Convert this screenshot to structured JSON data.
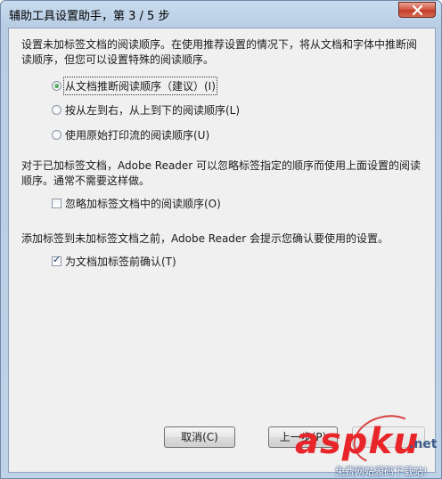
{
  "window": {
    "title": "辅助工具设置助手，第 3 / 5 步"
  },
  "section1": {
    "description": "设置未加标签文档的阅读顺序。在使用推荐设置的情况下，将从文档和字体中推断阅读顺序，但您可以设置特殊的阅读顺序。",
    "options": [
      {
        "label": "从文档推断阅读顺序（建议）(I)",
        "selected": true
      },
      {
        "label": "按从左到右，从上到下的阅读顺序(L)",
        "selected": false
      },
      {
        "label": "使用原始打印流的阅读顺序(U)",
        "selected": false
      }
    ]
  },
  "section2": {
    "description": "对于已加标签文档，Adobe Reader 可以忽略标签指定的顺序而使用上面设置的阅读顺序。通常不需要这样做。",
    "checkbox_label": "忽略加标签文档中的阅读顺序(O)",
    "checked": false
  },
  "section3": {
    "description": "添加标签到未加标签文档之前，Adobe Reader 会提示您确认要使用的设置。",
    "checkbox_label": "为文档加标签前确认(T)",
    "checked": true
  },
  "buttons": {
    "cancel": "取消(C)",
    "back": "上一步(P)"
  },
  "watermark": {
    "brand": "aspku",
    "suffix": ".net",
    "slogan": "免费网站源码下载站!"
  }
}
